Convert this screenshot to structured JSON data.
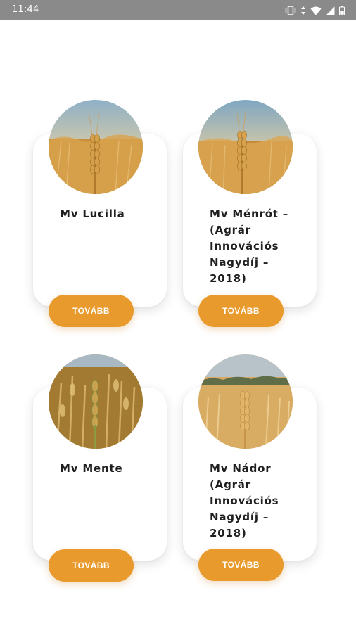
{
  "status_bar": {
    "time": "11:44",
    "icons": [
      "vibrate-icon",
      "data-arrows-icon",
      "wifi-icon",
      "signal-icon",
      "battery-icon"
    ]
  },
  "colors": {
    "accent": "#e99a2c",
    "status_bar": "#8a8a8a",
    "card_bg": "#ffffff",
    "title_text": "#1f1f1f"
  },
  "cards": [
    {
      "title": "Mv Lucilla",
      "image": "wheat-ear-photo",
      "button_label": "TOVÁBB"
    },
    {
      "title": "Mv Ménrót – (Agrár Innovációs Nagydíj – 2018)",
      "image": "wheat-ear-photo",
      "button_label": "TOVÁBB"
    },
    {
      "title": "Mv Mente",
      "image": "wheat-field-photo",
      "button_label": "TOVÁBB"
    },
    {
      "title": "Mv Nádor (Agrár Innovációs Nagydíj – 2018)",
      "image": "wheat-field-photo",
      "button_label": "TOVÁBB"
    }
  ]
}
